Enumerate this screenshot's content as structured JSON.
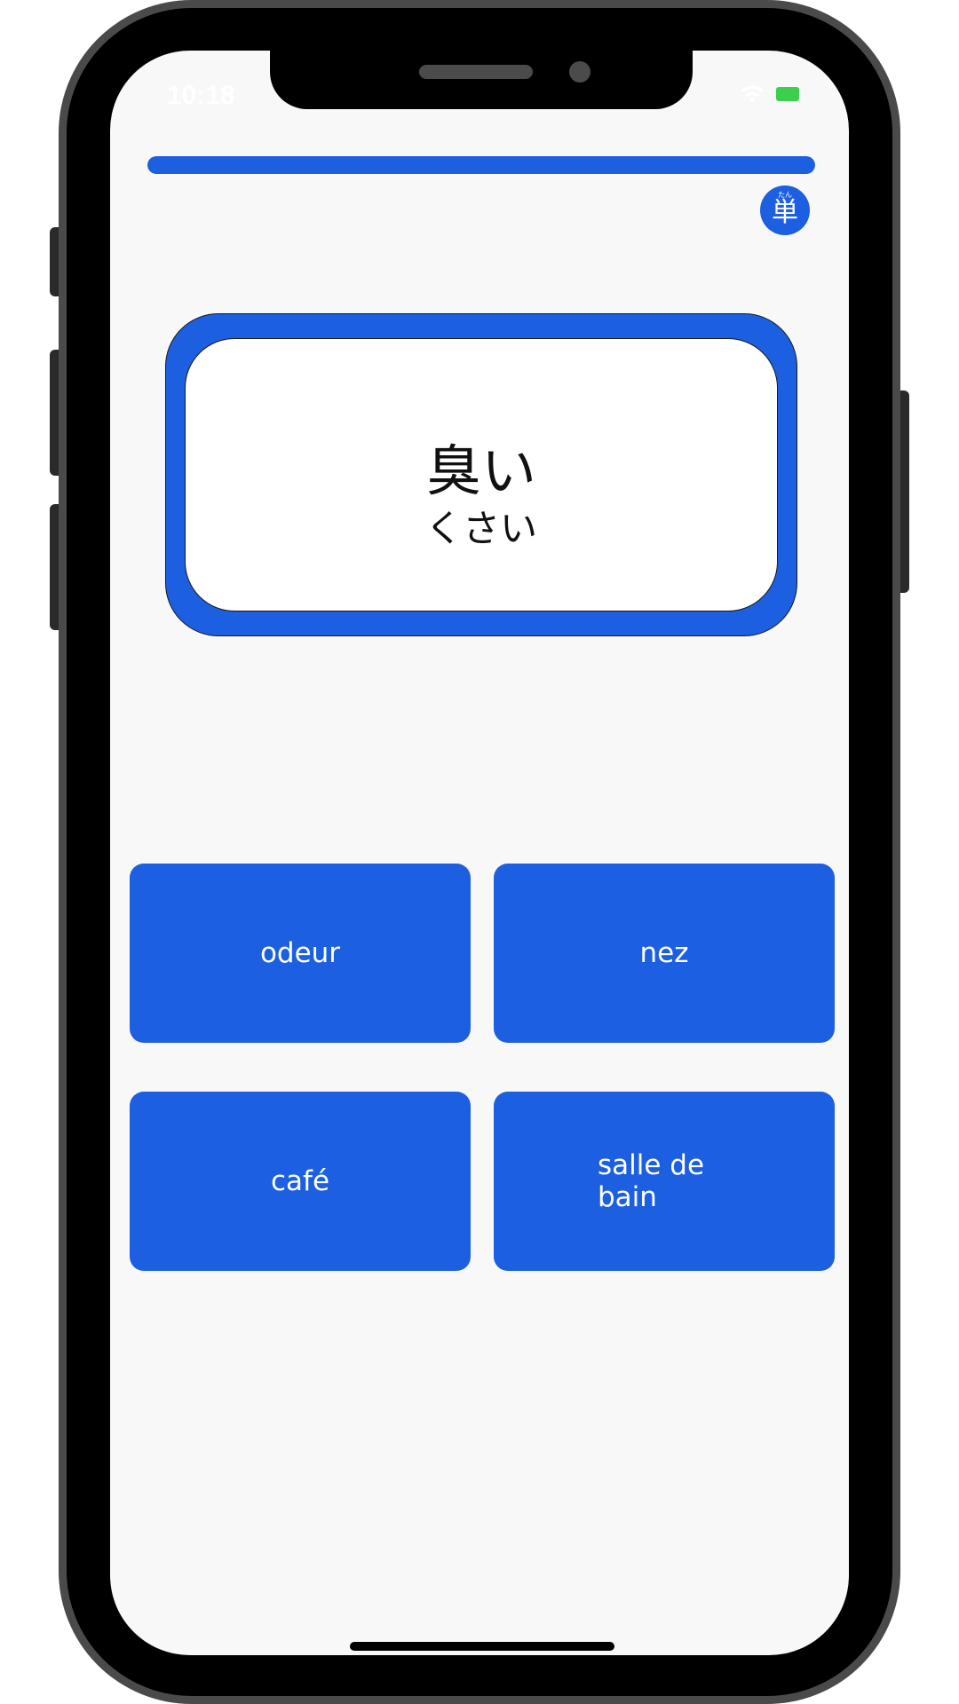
{
  "status_bar": {
    "time": "10:18"
  },
  "progress": {
    "fraction": 1.0
  },
  "badge": {
    "kanji": "単",
    "ruby": "たん"
  },
  "flashcard": {
    "word": "臭い",
    "reading": "くさい"
  },
  "answers": [
    {
      "label": "odeur"
    },
    {
      "label": "nez"
    },
    {
      "label": "café"
    },
    {
      "label": "salle de bain"
    }
  ],
  "colors": {
    "accent": "#1c5fe0",
    "background": "#f8f8f9",
    "card": "#ffffff"
  }
}
